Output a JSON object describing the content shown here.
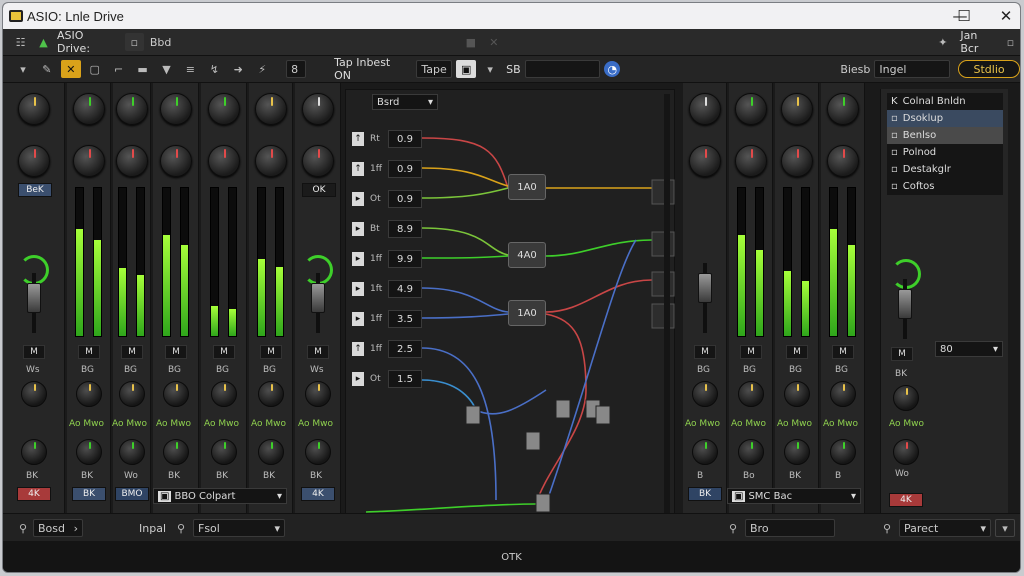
{
  "window": {
    "title": "ASIO: Lnle Drive",
    "minimize": "—",
    "maximize": "☐",
    "close": "✕"
  },
  "menubar": {
    "app_label": "ASIO Drive:",
    "item": "Bbd",
    "right_label": "Jan Bcr"
  },
  "toolbar": {
    "field1": "8",
    "label_main": "Tap Inbest ON",
    "dropdown": "Tape",
    "label_s": "SB",
    "preset_label": "Biesb",
    "preset_value": "Ingel",
    "preset_button": "Stdlio"
  },
  "left_strips": [
    {
      "mute": "M",
      "top_lbl": "BeK",
      "send": "Ws",
      "mid": "BK",
      "chan": "4K",
      "chan_color": "#a83a3a"
    },
    {
      "mute": "M",
      "top_lbl": "",
      "send": "BG",
      "mid": "BK",
      "chan": "BK",
      "chan_color": "#3b4f6e",
      "g": "Ao Mwo"
    },
    {
      "mute": "M",
      "top_lbl": "",
      "send": "BG",
      "mid": "Wo",
      "chan": "BMO",
      "chan_color": "#2f4464",
      "g": "Ao Mwo"
    },
    {
      "mute": "M",
      "top_lbl": "",
      "send": "BG",
      "mid": "BK",
      "chan": "",
      "chan_color": "#2f4464",
      "g": "Ao Mwo"
    },
    {
      "mute": "M",
      "top_lbl": "",
      "send": "BG",
      "mid": "BK",
      "chan": "",
      "chan_color": "#2f4464",
      "g": "Ao Mwo"
    },
    {
      "mute": "M",
      "top_lbl": "",
      "send": "BG",
      "mid": "BK",
      "chan": "",
      "chan_color": "#2f4464",
      "g": "Ao Mwo"
    },
    {
      "mute": "M",
      "top_lbl": "OK",
      "send": "Ws",
      "mid": "BK",
      "chan": "4K",
      "chan_color": "#3b4f6e",
      "g": "Ao Mwo"
    }
  ],
  "left_dropdown": "BBO Colpart",
  "right_dropdown": "SMC Bac",
  "matrix": {
    "header": "Bsrd",
    "inputs": [
      {
        "io": "↑",
        "label": "Rt",
        "value": "0.9"
      },
      {
        "io": "↑",
        "label": "1ff",
        "value": "0.9"
      },
      {
        "io": "▸",
        "label": "Ot",
        "value": "0.9"
      },
      {
        "io": "▸",
        "label": "Bt",
        "value": "8.9"
      },
      {
        "io": "▸",
        "label": "1ff",
        "value": "9.9"
      },
      {
        "io": "▸",
        "label": "1ft",
        "value": "4.9"
      },
      {
        "io": "▸",
        "label": "1ff",
        "value": "3.5"
      },
      {
        "io": "↑",
        "label": "1ff",
        "value": "2.5"
      },
      {
        "io": "▸",
        "label": "Ot",
        "value": "1.5"
      }
    ],
    "nodes": [
      "1A0",
      "4A0",
      "1A0"
    ]
  },
  "right_strips": [
    {
      "mute": "M",
      "send": "BG",
      "mid": "B",
      "chan": "BK",
      "g": "Ao Mwo"
    },
    {
      "mute": "M",
      "send": "BG",
      "mid": "Bo",
      "chan": "",
      "g": "Ao Mwo"
    },
    {
      "mute": "M",
      "send": "BG",
      "mid": "BK",
      "chan": "",
      "g": "Ao Mwo"
    },
    {
      "mute": "M",
      "send": "BG",
      "mid": "B",
      "chan": "",
      "g": "Ao Mwo"
    }
  ],
  "panel": {
    "items": [
      {
        "label": "Colnal Bnldn",
        "icon": "K"
      },
      {
        "label": "Dsoklup",
        "icon": "▫"
      },
      {
        "label": "Benlso",
        "icon": "▫"
      },
      {
        "label": "Polnod",
        "icon": "▫"
      },
      {
        "label": "Destakglr",
        "icon": "▫"
      },
      {
        "label": "Coftos",
        "icon": "▫"
      }
    ],
    "value": "80",
    "mute": "M",
    "chan": "4K",
    "send": "Wo",
    "g": "Ao Mwo",
    "mid": "BK"
  },
  "bottom": {
    "left_box": "Bosd",
    "input_label": "Inpal",
    "input_value": "Fsol",
    "mid_value": "Bro",
    "right_value": "Parect"
  },
  "status": {
    "text": "OTK"
  }
}
